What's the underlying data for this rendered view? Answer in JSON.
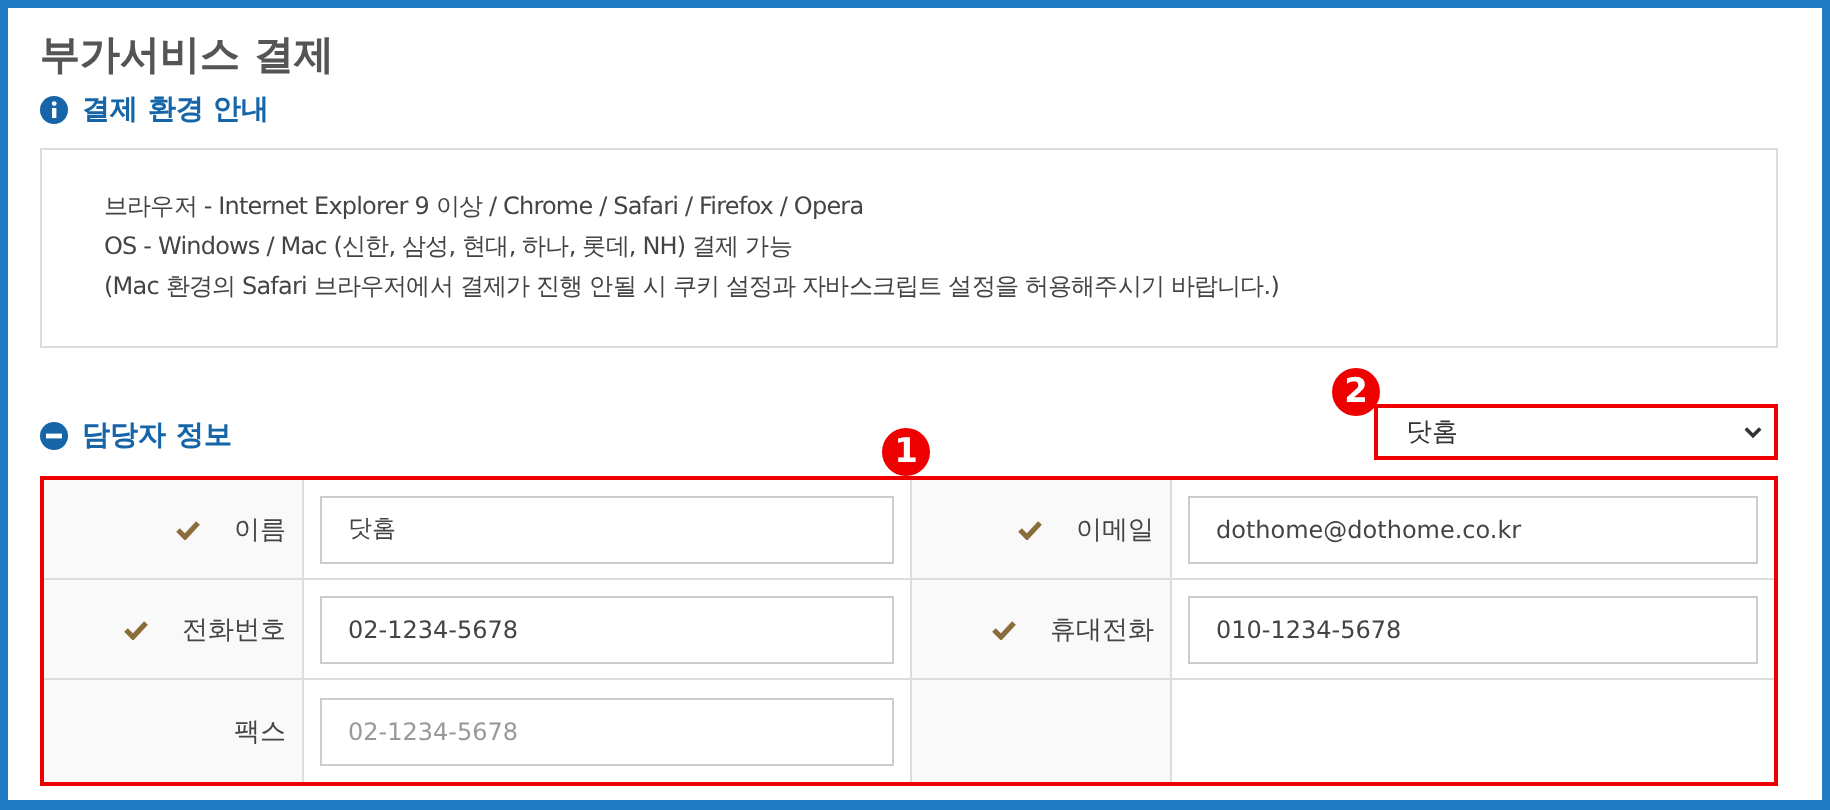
{
  "page_title": "부가서비스 결제",
  "payment_environment": {
    "heading": "결제 환경 안내",
    "lines": [
      "브라우저 - Internet Explorer 9 이상 / Chrome / Safari / Firefox / Opera",
      "OS - Windows / Mac (신한, 삼성, 현대, 하나, 롯데, NH) 결제 가능",
      "(Mac 환경의 Safari 브라우저에서 결제가 진행 안될 시 쿠키 설정과 자바스크립트 설정을 허용해주시기 바랍니다.)"
    ]
  },
  "contact_info": {
    "heading": "담당자 정보",
    "select_value": "닷홈",
    "select_marker": "2",
    "table_marker": "1",
    "rows": [
      {
        "fields": [
          {
            "label": "이름",
            "required": true,
            "value": "닷홈"
          },
          {
            "label": "이메일",
            "required": true,
            "value": "dothome@dothome.co.kr"
          }
        ]
      },
      {
        "fields": [
          {
            "label": "전화번호",
            "required": true,
            "value": "02-1234-5678"
          },
          {
            "label": "휴대전화",
            "required": true,
            "value": "010-1234-5678"
          }
        ]
      },
      {
        "fields": [
          {
            "label": "팩스",
            "required": false,
            "placeholder": "02-1234-5678"
          }
        ]
      }
    ]
  }
}
